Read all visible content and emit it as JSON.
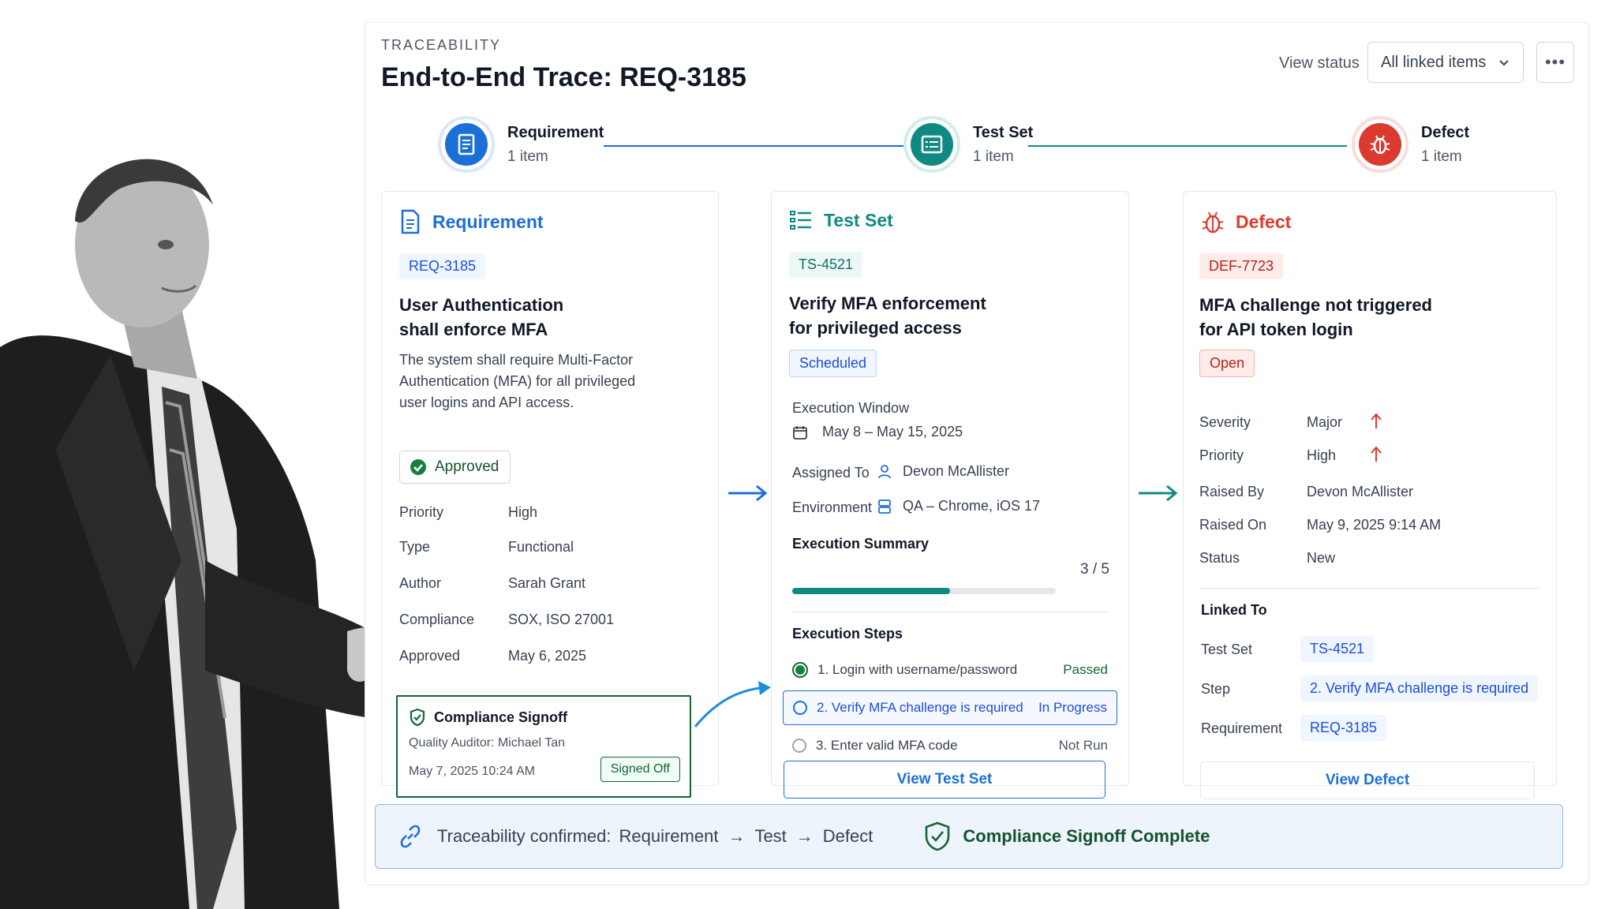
{
  "header": {
    "eyebrow": "TRACEABILITY",
    "title": "End-to-End Trace: REQ-3185",
    "view_status_label": "View status",
    "view_status_value": "All linked items",
    "more_label": "•••"
  },
  "flow": [
    {
      "title": "Requirement",
      "subtitle": "1 item"
    },
    {
      "title": "Test Set",
      "subtitle": "1 item"
    },
    {
      "title": "Defect",
      "subtitle": "1 item"
    }
  ],
  "requirement": {
    "heading": "Requirement",
    "id": "REQ-3185",
    "title_line1": "User Authentication",
    "title_line2": "shall enforce MFA",
    "desc_line1": "The system shall require Multi-Factor",
    "desc_line2": "Authentication (MFA) for all privileged",
    "desc_line3": "user logins and API access.",
    "status": "Approved",
    "fields": [
      {
        "label": "Priority",
        "value": "High"
      },
      {
        "label": "Type",
        "value": "Functional"
      },
      {
        "label": "Author",
        "value": "Sarah Grant"
      },
      {
        "label": "Compliance",
        "value": "SOX, ISO 27001"
      },
      {
        "label": "Approved",
        "value": "May 6, 2025"
      }
    ],
    "signoff": {
      "title": "Compliance Signoff",
      "auditor": "Quality Auditor: Michael Tan",
      "datetime": "May 7, 2025  10:24 AM",
      "badge": "Signed Off"
    }
  },
  "testset": {
    "heading": "Test Set",
    "id": "TS-4521",
    "title_line1": "Verify MFA enforcement",
    "title_line2": "for privileged access",
    "status": "Scheduled",
    "window_label": "Execution Window",
    "window_value": "May 8 – May 15, 2025",
    "assigned_label": "Assigned To",
    "assigned_value": "Devon McAllister",
    "env_label": "Environment",
    "env_value": "QA – Chrome, iOS 17",
    "summary_label": "Execution Summary",
    "summary_value": "3 / 5",
    "progress": 0.6,
    "steps_label": "Execution Steps",
    "steps": [
      {
        "label": "1.  Login with username/password",
        "status": "Passed"
      },
      {
        "label": "2.  Verify MFA challenge is required",
        "status": "In Progress"
      },
      {
        "label": "3.  Enter valid MFA code",
        "status": "Not Run"
      }
    ],
    "button": "View Test Set"
  },
  "defect": {
    "heading": "Defect",
    "id": "DEF-7723",
    "title_line1": "MFA challenge not triggered",
    "title_line2": "for API token login",
    "status": "Open",
    "fields": [
      {
        "label": "Severity",
        "value": "Major"
      },
      {
        "label": "Priority",
        "value": "High"
      },
      {
        "label": "Raised By",
        "value": "Devon McAllister"
      },
      {
        "label": "Raised On",
        "value": "May 9, 2025  9:14 AM"
      },
      {
        "label": "Status",
        "value": "New"
      }
    ],
    "linked_label": "Linked To",
    "links": [
      {
        "label": "Test Set",
        "value": "TS-4521"
      },
      {
        "label": "Step",
        "value": "2. Verify MFA challenge is required"
      },
      {
        "label": "Requirement",
        "value": "REQ-3185"
      }
    ],
    "button": "View Defect"
  },
  "banner": {
    "prefix": "Traceability confirmed:",
    "item1": "Requirement",
    "item2": "Test",
    "item3": "Defect",
    "compliance": "Compliance Signoff Complete"
  },
  "colors": {
    "requirement_blue": "#1d6fd8",
    "testset_teal": "#0f8a82",
    "defect_red": "#dc3a2e",
    "approved_green": "#166534"
  }
}
